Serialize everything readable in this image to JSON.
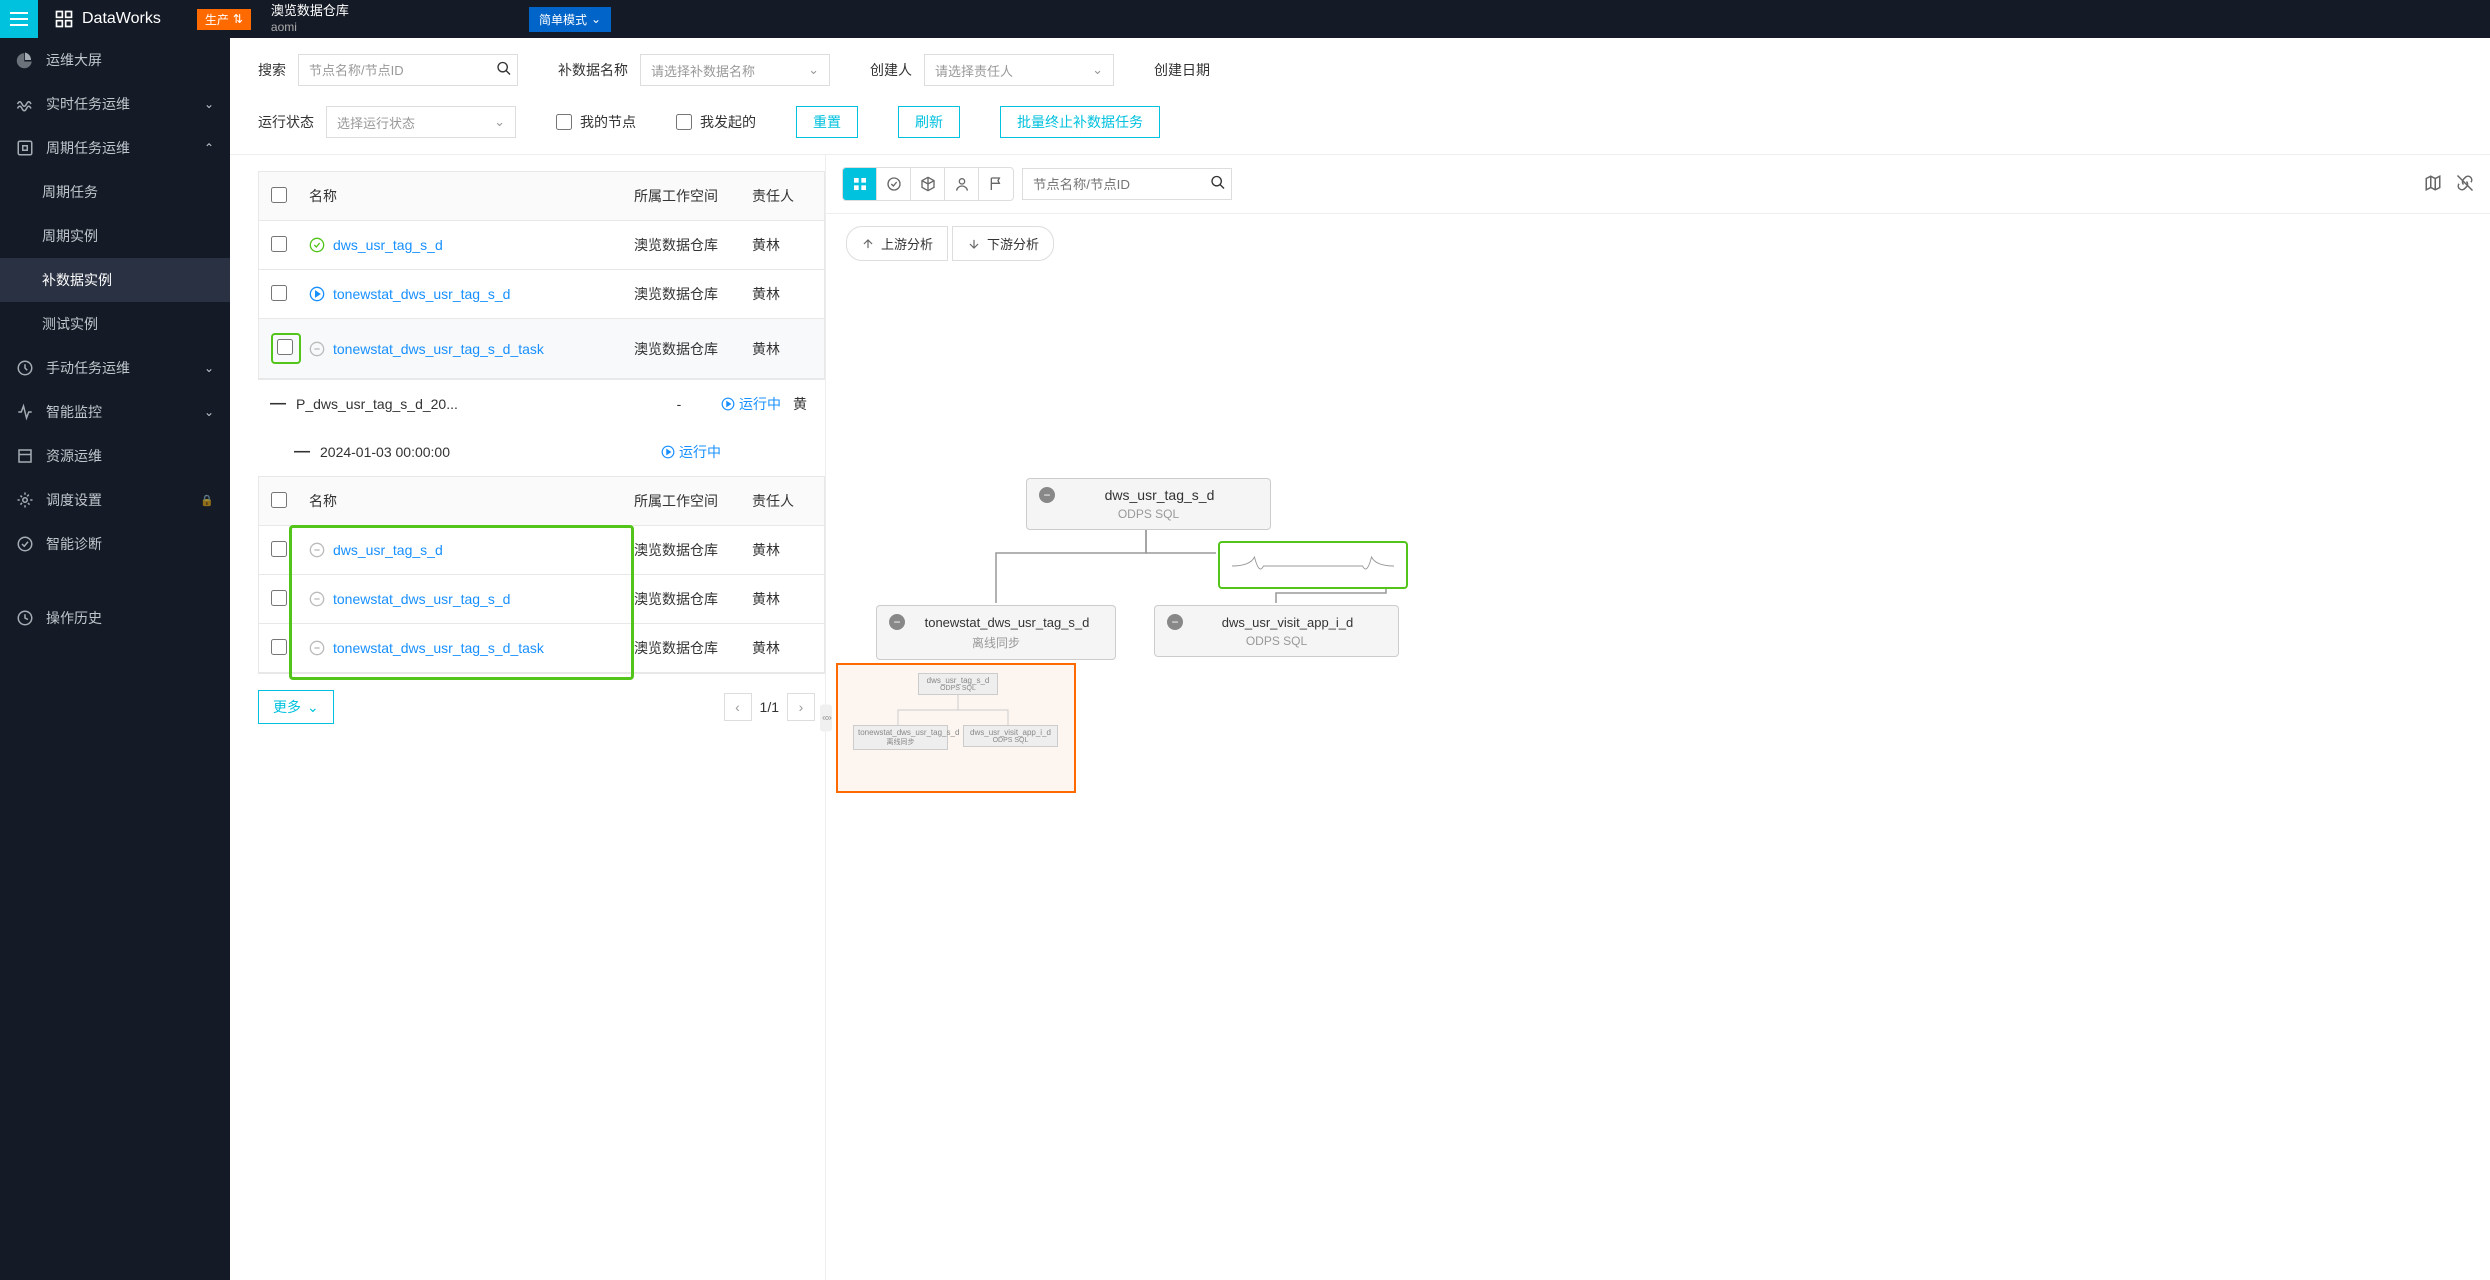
{
  "header": {
    "product": "DataWorks",
    "env_badge": "生产",
    "workspace_name": "澳览数据仓库",
    "workspace_code": "aomi",
    "mode": "简单模式"
  },
  "sidebar": {
    "items": [
      {
        "label": "运维大屏",
        "icon": "dashboard"
      },
      {
        "label": "实时任务运维",
        "icon": "realtime",
        "chevron": true
      },
      {
        "label": "周期任务运维",
        "icon": "cycle",
        "chevron": true,
        "expanded": true
      },
      {
        "label": "周期任务",
        "sub": true
      },
      {
        "label": "周期实例",
        "sub": true
      },
      {
        "label": "补数据实例",
        "sub": true,
        "active": true
      },
      {
        "label": "测试实例",
        "sub": true
      },
      {
        "label": "手动任务运维",
        "icon": "manual",
        "chevron": true
      },
      {
        "label": "智能监控",
        "icon": "monitor",
        "chevron": true
      },
      {
        "label": "资源运维",
        "icon": "resource"
      },
      {
        "label": "调度设置",
        "icon": "schedule",
        "lock": true
      },
      {
        "label": "智能诊断",
        "icon": "diagnose"
      },
      {
        "label": "操作历史",
        "icon": "history"
      }
    ]
  },
  "filters": {
    "search_label": "搜索",
    "search_placeholder": "节点名称/节点ID",
    "backfill_label": "补数据名称",
    "backfill_placeholder": "请选择补数据名称",
    "creator_label": "创建人",
    "creator_placeholder": "请选择责任人",
    "create_date_label": "创建日期",
    "status_label": "运行状态",
    "status_placeholder": "选择运行状态",
    "my_node": "我的节点",
    "my_triggered": "我发起的",
    "reset_btn": "重置",
    "refresh_btn": "刷新",
    "batch_stop_btn": "批量终止补数据任务"
  },
  "table": {
    "columns": {
      "name": "名称",
      "workspace": "所属工作空间",
      "owner": "责任人"
    },
    "rows1": [
      {
        "status": "success",
        "name": "dws_usr_tag_s_d",
        "ws": "澳览数据仓库",
        "owner": "黄林"
      },
      {
        "status": "running",
        "name": "tonewstat_dws_usr_tag_s_d",
        "ws": "澳览数据仓库",
        "owner": "黄林"
      },
      {
        "status": "pending",
        "name": "tonewstat_dws_usr_tag_s_d_task",
        "ws": "澳览数据仓库",
        "owner": "黄林",
        "highlight": true
      }
    ],
    "group1": {
      "name": "P_dws_usr_tag_s_d_20...",
      "dash": "-",
      "status": "运行中",
      "owner_initial": "黄"
    },
    "group2": {
      "name": "2024-01-03 00:00:00",
      "status": "运行中"
    },
    "rows2": [
      {
        "status": "pending",
        "name": "dws_usr_tag_s_d",
        "ws": "澳览数据仓库",
        "owner": "黄林"
      },
      {
        "status": "pending",
        "name": "tonewstat_dws_usr_tag_s_d",
        "ws": "澳览数据仓库",
        "owner": "黄林"
      },
      {
        "status": "pending",
        "name": "tonewstat_dws_usr_tag_s_d_task",
        "ws": "澳览数据仓库",
        "owner": "黄林"
      }
    ],
    "more": "更多",
    "page_current": "1",
    "page_total": "1"
  },
  "dag": {
    "toolbar_placeholder": "节点名称/节点ID",
    "upstream": "上游分析",
    "downstream": "下游分析",
    "nodes": [
      {
        "id": "n1",
        "title": "dws_usr_tag_s_d",
        "sub": "ODPS SQL"
      },
      {
        "id": "n2",
        "title": "tonewstat_dws_usr_tag_s_d",
        "sub": "离线同步"
      },
      {
        "id": "n3",
        "title": "dws_usr_visit_app_i_d",
        "sub": "ODPS SQL"
      }
    ],
    "minimap": {
      "n1": "dws_usr_tag_s_d",
      "n1s": "ODPS SQL",
      "n2": "tonewstat_dws_usr_tag_s_d",
      "n2s": "离线同步",
      "n3": "dws_usr_visit_app_i_d",
      "n3s": "ODPS SQL"
    }
  }
}
